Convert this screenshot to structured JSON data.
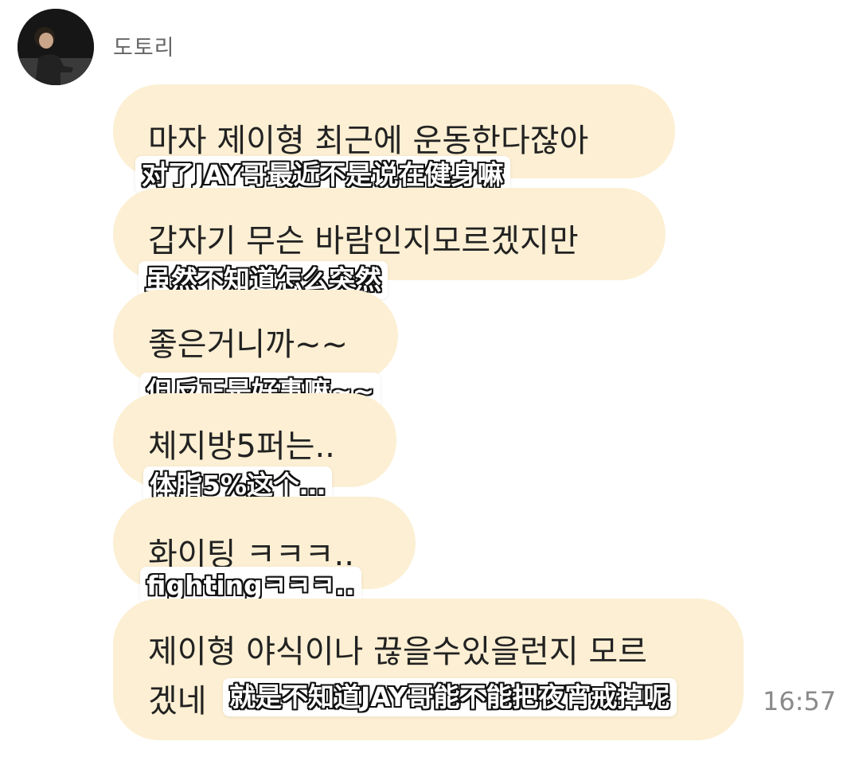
{
  "chat": {
    "sender": "도토리",
    "timestamp": "16:57",
    "messages": [
      {
        "text": "마자 제이형 최근에 운동한다잖아",
        "caption": "对了JAY哥最近不是说在健身嘛"
      },
      {
        "text": "갑자기 무슨 바람인지모르겠지만",
        "caption": "虽然不知道怎么突然"
      },
      {
        "text": "좋은거니까~~",
        "caption": "但反正是好事嘛~~"
      },
      {
        "text": "체지방5퍼는..",
        "caption": "体脂5%这个…"
      },
      {
        "text": "화이팅 ㅋㅋㅋ..",
        "caption": "fightingㅋㅋㅋ.."
      },
      {
        "text_line1": "제이형 야식이나 끊을수있을런지 모르",
        "text_line2": "겠네",
        "caption": "就是不知道JAY哥能不能把夜宵戒掉呢"
      }
    ]
  },
  "colors": {
    "bubble": "#fcefd3",
    "sender_name": "#666666",
    "timestamp": "#8a8a8a"
  }
}
